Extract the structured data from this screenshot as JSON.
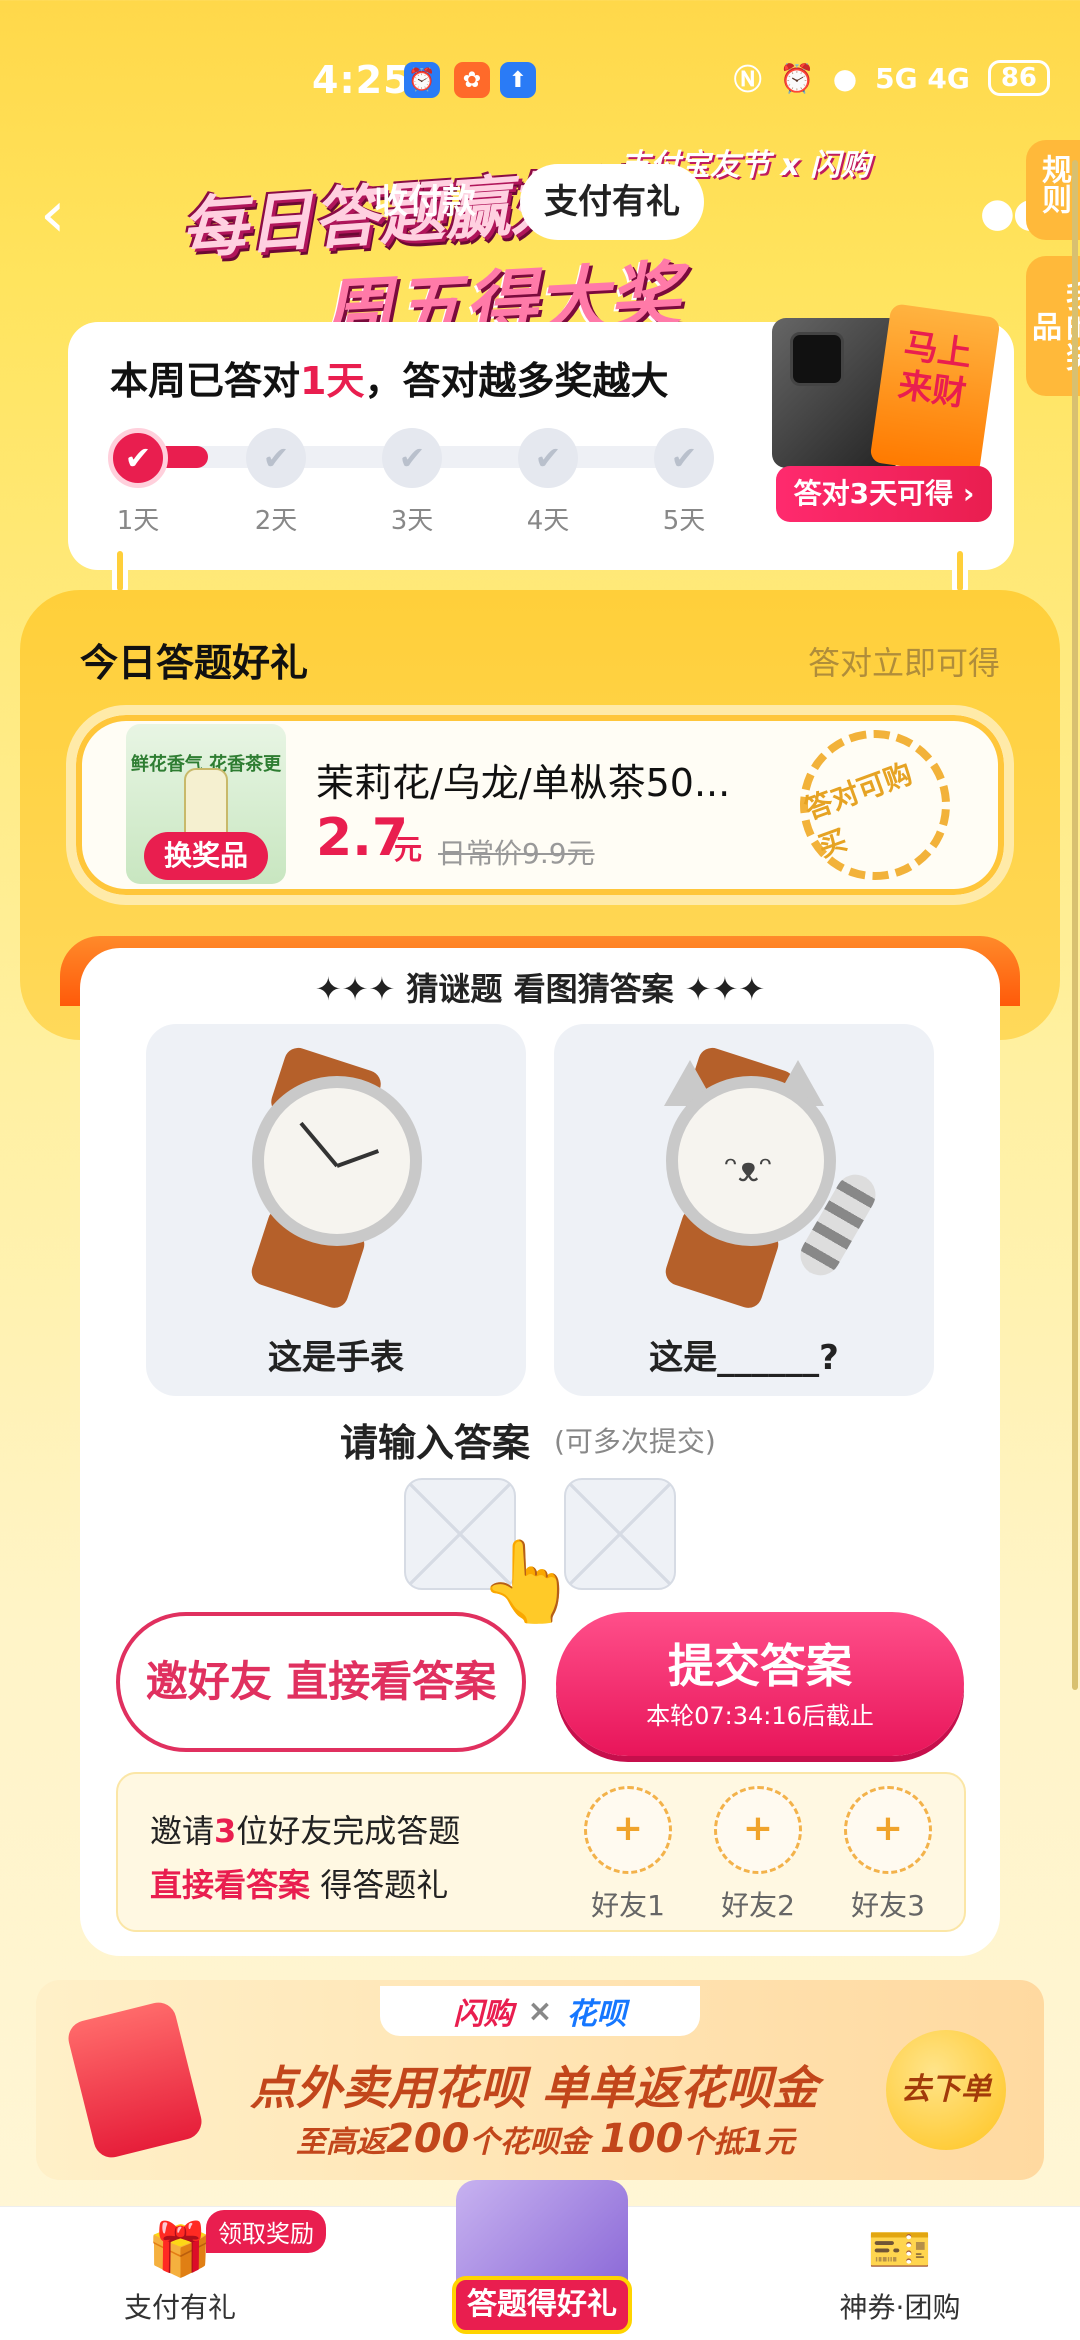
{
  "status_bar": {
    "time": "4:25",
    "network": "5G 4G",
    "battery": "86"
  },
  "header": {
    "back_icon": "chevron-left-icon",
    "banner_title": "每日答题赢好礼",
    "banner_sub": "周五得大奖",
    "banner_brand": "支付宝友节 x 闪购",
    "tabs": [
      {
        "label": "收付款",
        "active": false
      },
      {
        "label": "支付有礼",
        "active": true
      }
    ],
    "more_icon": "more-icon",
    "side_tabs": [
      "规则",
      "我的奖品"
    ]
  },
  "progress": {
    "title_prefix": "本周已答对",
    "days_done": "1天",
    "title_suffix": "，答对越多奖越大",
    "days": [
      "1天",
      "2天",
      "3天",
      "4天",
      "5天"
    ],
    "completed": 1,
    "reward_pill": "答对3天可得 ›",
    "redcard_text": "马上来财"
  },
  "gift": {
    "title": "今日答题好礼",
    "subtitle": "答对立即可得",
    "product": {
      "name": "茉莉花/乌龙/单枞茶50...",
      "image_caption": "鲜花香气 花香茶更香",
      "swap_badge": "换奖品",
      "price": "2.7",
      "unit": "元",
      "original_price": "日常价9.9元"
    },
    "stamp": "答对可购买"
  },
  "quiz": {
    "heading": "✦✦✦ 猜谜题 看图猜答案 ✦✦✦",
    "left_caption": "这是手表",
    "right_caption": "这是______?",
    "answer_label": "请输入答案",
    "answer_hint": "(可多次提交)",
    "invite_button": "邀好友 直接看答案",
    "submit_main": "提交答案",
    "submit_sub": "本轮07:34:16后截止"
  },
  "invite": {
    "line1_a": "邀请",
    "line1_num": "3",
    "line1_b": "位好友完成答题",
    "line2_hl": "直接看答案",
    "line2_b": " 得答题礼",
    "friends": [
      "好友1",
      "好友2",
      "好友3"
    ]
  },
  "promo": {
    "logo_a": "闪购",
    "logo_x": "×",
    "logo_b": "花呗",
    "title": "点外卖用花呗 单单返花呗金",
    "sub_a": "至高返",
    "sub_num1": "200",
    "sub_b": "个花呗金 ",
    "sub_num2": "100",
    "sub_c": "个抵1元",
    "button": "去下单"
  },
  "bottom_nav": {
    "left_label": "支付有礼",
    "left_badge": "领取奖励",
    "center_label": "答题得好礼",
    "right_label": "神券·团购"
  },
  "colors": {
    "accent": "#e91e4f",
    "background": "#ffd84a",
    "gold": "#ffc63a"
  }
}
